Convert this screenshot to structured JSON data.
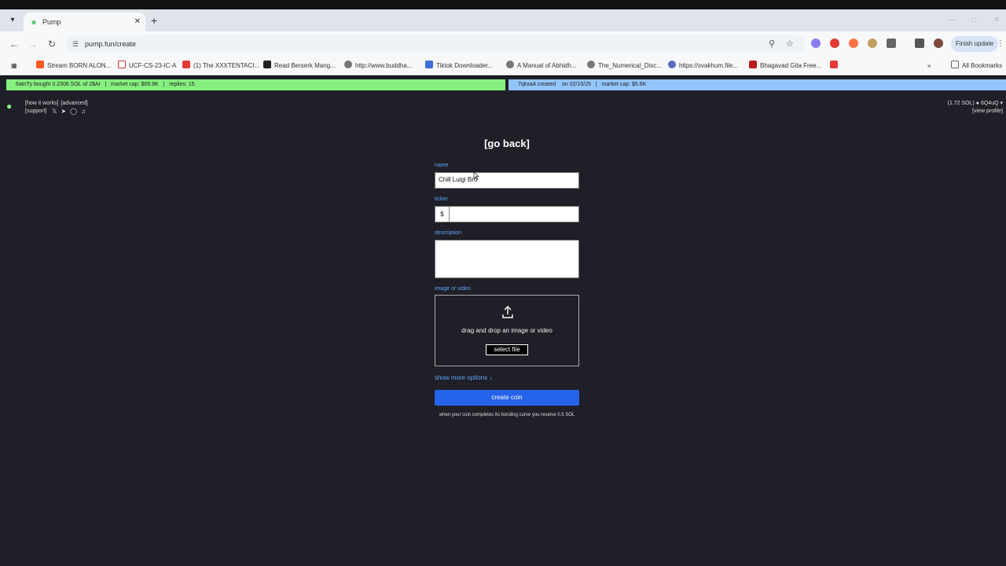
{
  "browser": {
    "tab_title": "Pump",
    "url": "pump.fun/create",
    "finish_update": "Finish update",
    "bookmarks": [
      "Stream BORN ALON...",
      "UCF-CS-23-IC-A",
      "(1) The XXXTENTACI...",
      "Read Berserk Mang...",
      "http://www.buddha...",
      "Tiktok Downloader...",
      "A Manual of Abhidh...",
      "The_Numerical_Disc...",
      "https://svakhum.file...",
      "Bhagavad Gita Free..."
    ],
    "all_bookmarks": "All Bookmarks"
  },
  "ticker": {
    "green": "6atnTy bought 0.2306 SOL of 2$AI   |   market cap: $66.9K   |   replies: 15",
    "blue": "7qkxaA created    on 02/10/25   |   market cap: $5.6K"
  },
  "nav": {
    "how_it_works": "[how it works]",
    "advanced": "[advanced]",
    "support": "[support]"
  },
  "wallet": {
    "balance": "(1.72 SOL) ● 6Q4uQ ▾",
    "view_profile": "[view profile]"
  },
  "form": {
    "go_back": "[go back]",
    "name_label": "name",
    "name_value": "Chill Luigi Bro",
    "ticker_label": "ticker",
    "ticker_prefix": "$",
    "ticker_value": "",
    "description_label": "description",
    "description_value": "",
    "image_label": "image or video",
    "drop_text": "drag and drop an image or video",
    "select_file": "select file",
    "more_options": "show more options ↓",
    "create_coin": "create coin",
    "bonding_note": "when your coin completes its bonding curve you receive 0.5 SOL"
  }
}
